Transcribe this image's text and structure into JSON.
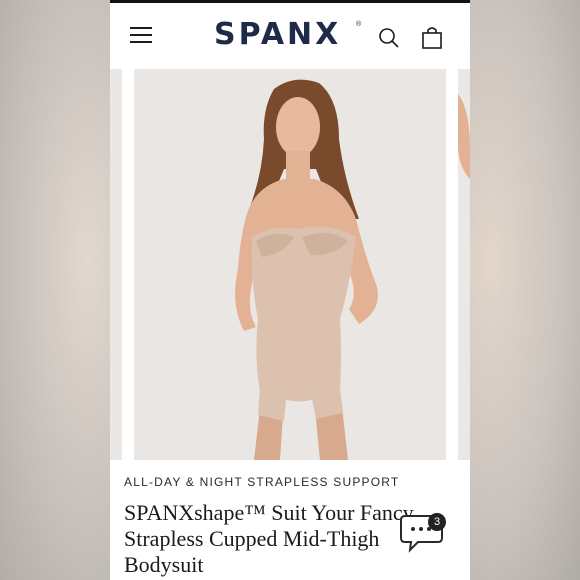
{
  "header": {
    "logo_text": "SPANX",
    "logo_mark": "®",
    "menu_icon": "hamburger-menu-icon",
    "search_icon": "search-icon",
    "bag_icon": "shopping-bag-icon"
  },
  "product": {
    "eyebrow": "ALL-DAY & NIGHT STRAPLESS SUPPORT",
    "title_lines": [
      "SPANXshape™ Suit Your Fancy",
      "Strapless Cupped Mid-Thigh",
      "Bodysuit"
    ]
  },
  "chat": {
    "icon": "chat-bubble-icon",
    "badge_count": "3"
  },
  "colors": {
    "brand_navy": "#1e2a47",
    "garment_nude": "#dcc2ae",
    "background": "#e8e5e3"
  }
}
